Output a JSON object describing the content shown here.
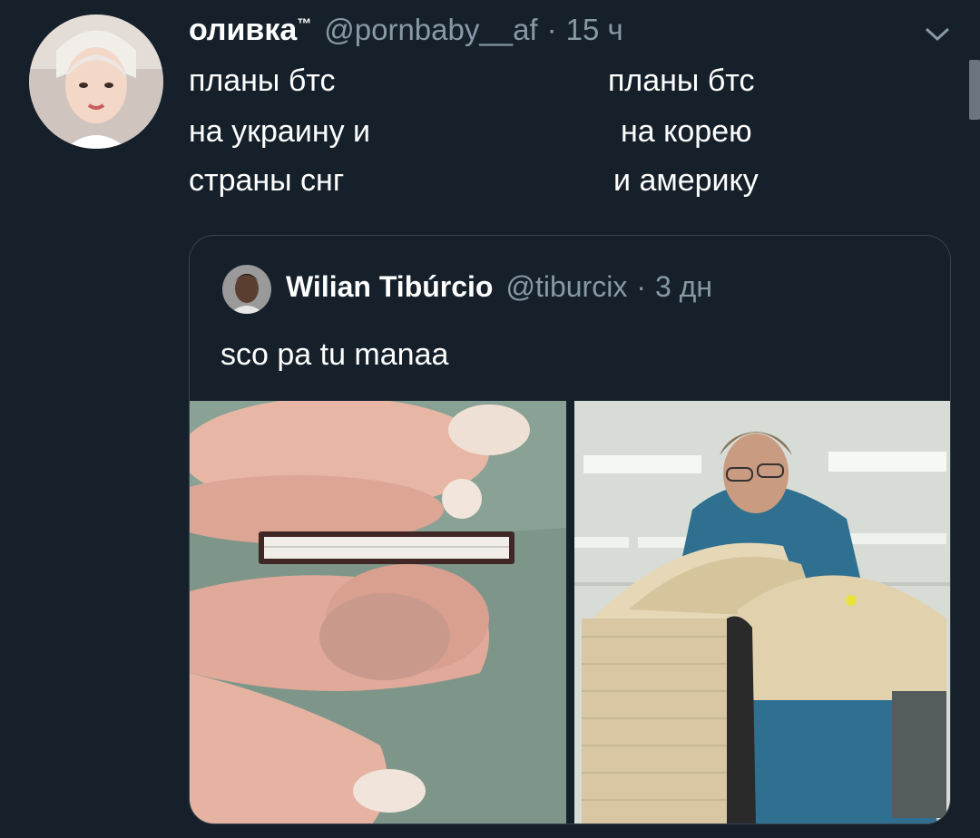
{
  "tweet": {
    "author": {
      "display_name": "оливка",
      "display_name_suffix": "™",
      "handle": "@pornbaby__af",
      "separator": "·",
      "timestamp": "15 ч"
    },
    "text_left": [
      "планы бтс",
      "на украину и",
      "страны снг"
    ],
    "text_right": [
      "планы бтс",
      "на корею",
      "и америку"
    ],
    "menu_icon": "chevron-down-icon",
    "quoted": {
      "display_name": "Wilian Tibúrcio",
      "handle": "@tiburcix",
      "separator": "·",
      "timestamp": "3 дн",
      "text": "sco pa tu manaa",
      "media": [
        {
          "description_icon": "tiny-book-photo"
        },
        {
          "description_icon": "huge-book-photo"
        }
      ]
    }
  },
  "colors": {
    "background": "#15202b",
    "secondary_text": "#8899a6",
    "primary_text": "#ffffff",
    "border": "#38444d"
  }
}
